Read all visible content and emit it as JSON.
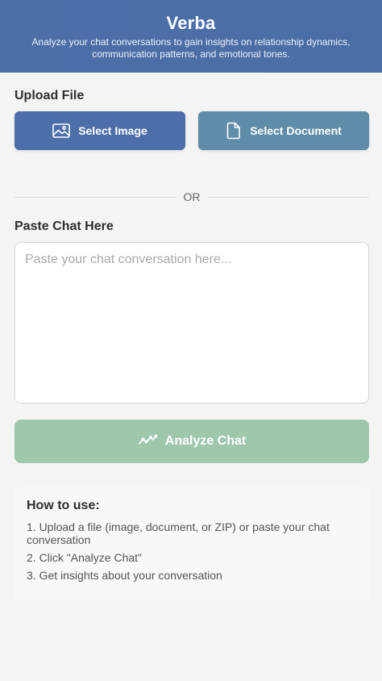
{
  "header": {
    "title": "Verba",
    "subtitle": "Analyze your chat conversations to gain insights on relationship dynamics, communication patterns, and emotional tones."
  },
  "upload": {
    "label": "Upload File",
    "select_image_label": "Select Image",
    "select_image_icon": "image-icon",
    "select_document_label": "Select Document",
    "select_document_icon": "document-icon"
  },
  "divider": {
    "text": "OR"
  },
  "paste": {
    "label": "Paste Chat Here",
    "placeholder": "Paste your chat conversation here...",
    "value": ""
  },
  "analyze": {
    "label": "Analyze Chat",
    "icon": "trend-line-icon"
  },
  "howto": {
    "title": "How to use:",
    "steps": [
      "1. Upload a file (image, document, or ZIP) or paste your chat conversation",
      "2. Click \"Analyze Chat\"",
      "3. Get insights about your conversation"
    ]
  },
  "colors": {
    "header_bg": "#4c6fa8",
    "select_image_bg": "#4d6fa9",
    "select_document_bg": "#5f8ca9",
    "analyze_bg": "#9fc7ac",
    "page_bg": "#f4f4f4"
  }
}
